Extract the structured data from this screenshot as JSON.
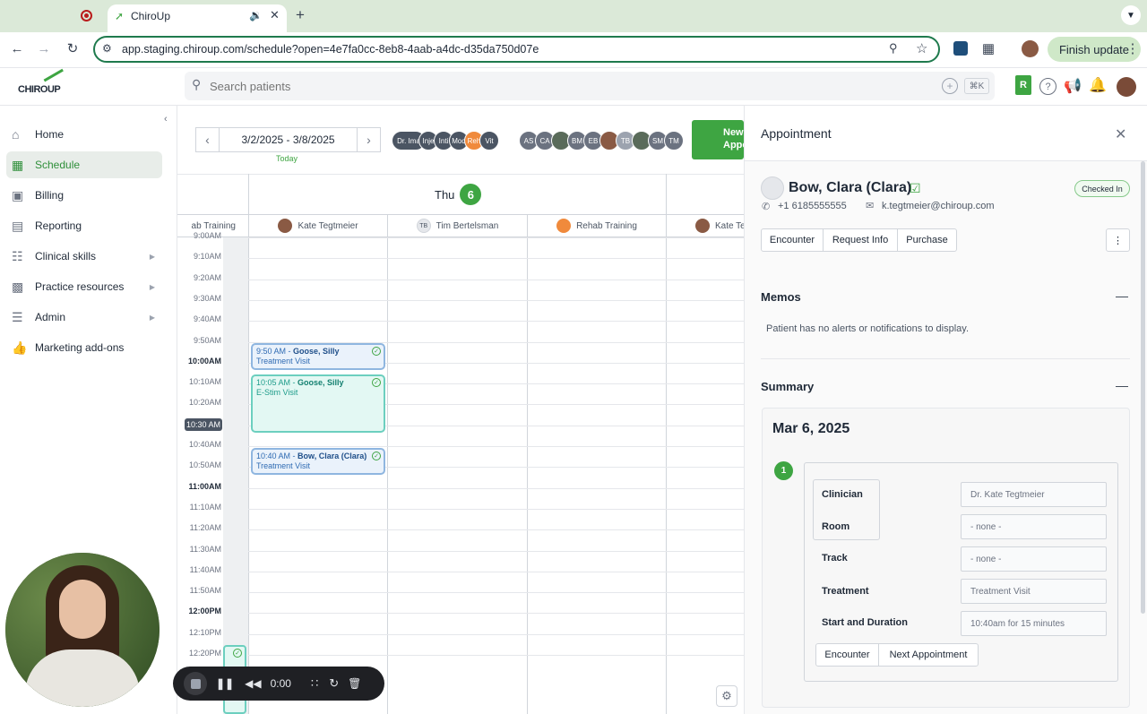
{
  "browser": {
    "tab_title": "ChiroUp",
    "url": "app.staging.chiroup.com/schedule?open=4e7fa0cc-8eb8-4aab-a4dc-d35da750d07e",
    "finish_update": "Finish update",
    "new_tab": "+"
  },
  "app": {
    "logo": "CHIROUP",
    "search_placeholder": "Search patients",
    "shortcut": "⌘K"
  },
  "sidebar": {
    "items": [
      {
        "label": "Home",
        "icon": "home-icon"
      },
      {
        "label": "Schedule",
        "icon": "calendar-icon"
      },
      {
        "label": "Billing",
        "icon": "billing-icon"
      },
      {
        "label": "Reporting",
        "icon": "chart-icon"
      },
      {
        "label": "Clinical skills",
        "icon": "book-icon"
      },
      {
        "label": "Practice resources",
        "icon": "building-icon"
      },
      {
        "label": "Admin",
        "icon": "menu-icon"
      },
      {
        "label": "Marketing add-ons",
        "icon": "thumbs-up-icon"
      }
    ]
  },
  "schedule": {
    "date_range": "3/2/2025 - 3/8/2025",
    "today": "Today",
    "day_name": "Thu",
    "day_num": "6",
    "new_appt": "New Appointment",
    "filters": [
      "Dr. Ima",
      "Inje",
      "Inti",
      "Mod",
      "Reh",
      "Vit"
    ],
    "clinicians": [
      "AS",
      "CA",
      "",
      "BM",
      "EB",
      "",
      "TB",
      "",
      "SM",
      "TM"
    ],
    "columns": [
      "ab Training",
      "Kate Tegtmeier",
      "Tim Bertelsman",
      "Rehab Training",
      "Kate Te"
    ],
    "tb_initials": "TB",
    "times": [
      "9:00AM",
      "9:10AM",
      "9:20AM",
      "9:30AM",
      "9:40AM",
      "9:50AM",
      "10:00AM",
      "10:10AM",
      "10:20AM",
      "10:30 AM",
      "10:40AM",
      "10:50AM",
      "11:00AM",
      "11:10AM",
      "11:20AM",
      "11:30AM",
      "11:40AM",
      "11:50AM",
      "12:00PM",
      "12:10PM",
      "12:20PM"
    ],
    "appointments": [
      {
        "time": "9:50 AM - ",
        "name": "Goose, Silly",
        "type": "Treatment Visit"
      },
      {
        "time": "10:05 AM - ",
        "name": "Goose, Silly",
        "type": "E-Stim Visit"
      },
      {
        "time": "10:40 AM - ",
        "name": "Bow, Clara (Clara)",
        "type": "Treatment Visit"
      }
    ]
  },
  "panel": {
    "title": "Appointment",
    "patient_name": "Bow, Clara (Clara)",
    "status": "Checked In",
    "phone": "+1 6185555555",
    "email": "k.tegtmeier@chiroup.com",
    "tabs": [
      "Encounter",
      "Request Info",
      "Purchase"
    ],
    "memos_title": "Memos",
    "memos_text": "Patient has no alerts or notifications to display.",
    "summary_title": "Summary",
    "summary_date": "Mar 6, 2025",
    "index": "1",
    "fields": [
      {
        "label": "Clinician",
        "value": "Dr. Kate Tegtmeier"
      },
      {
        "label": "Room",
        "value": "- none -"
      },
      {
        "label": "Track",
        "value": "- none -"
      },
      {
        "label": "Treatment",
        "value": "Treatment Visit"
      },
      {
        "label": "Start and Duration",
        "value": "10:40am for 15 minutes"
      }
    ],
    "buttons": [
      "Encounter",
      "Next Appointment"
    ]
  },
  "recorder": {
    "time": "0:00"
  },
  "colors": {
    "brand_green": "#3ea542",
    "teal": "#1e9c8a",
    "blue": "#2f6bb3"
  }
}
